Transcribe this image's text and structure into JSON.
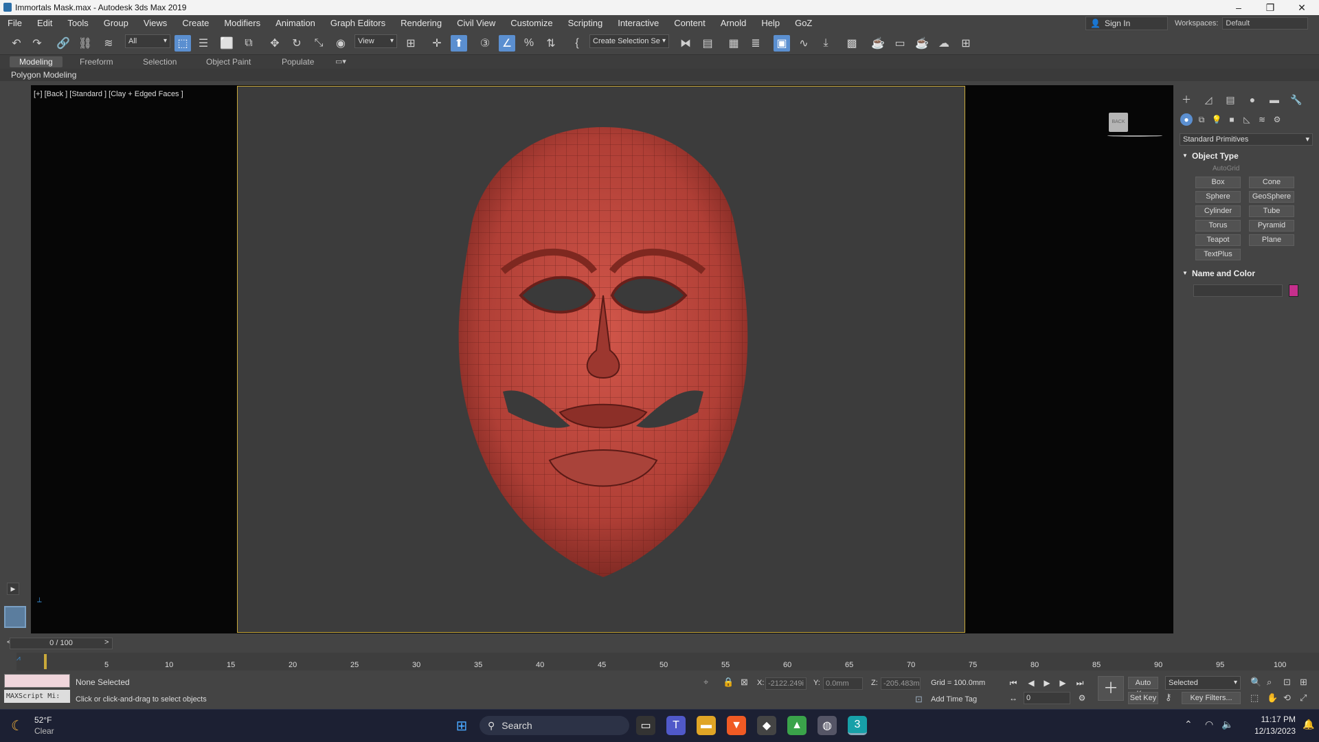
{
  "title": "Immortals Mask.max - Autodesk 3ds Max 2019",
  "menu": [
    "File",
    "Edit",
    "Tools",
    "Group",
    "Views",
    "Create",
    "Modifiers",
    "Animation",
    "Graph Editors",
    "Rendering",
    "Civil View",
    "Customize",
    "Scripting",
    "Interactive",
    "Content",
    "Arnold",
    "Help",
    "GoZ"
  ],
  "signin": "Sign In",
  "workspace": {
    "label": "Workspaces:",
    "value": "Default"
  },
  "toolbar": {
    "filter": "All",
    "refcoord": "View",
    "selset": "Create Selection Se"
  },
  "ribbon": {
    "tabs": [
      "Modeling",
      "Freeform",
      "Selection",
      "Object Paint",
      "Populate"
    ],
    "panel": "Polygon Modeling"
  },
  "viewport": {
    "label": "[+] [Back ] [Standard ] [Clay + Edged Faces ]",
    "viewcube": "BACK"
  },
  "command_panel": {
    "dropdown": "Standard Primitives",
    "object_type": "Object Type",
    "autogrid": "AutoGrid",
    "buttons": [
      "Box",
      "Cone",
      "Sphere",
      "GeoSphere",
      "Cylinder",
      "Tube",
      "Torus",
      "Pyramid",
      "Teapot",
      "Plane",
      "TextPlus"
    ],
    "name_and_color": "Name and Color",
    "object_color": "#c62f8d"
  },
  "timeline": {
    "slider": "0 / 100",
    "ticks": [
      "5",
      "10",
      "15",
      "20",
      "25",
      "30",
      "35",
      "40",
      "45",
      "50",
      "55",
      "60",
      "65",
      "70",
      "75",
      "80",
      "85",
      "90",
      "95",
      "100"
    ]
  },
  "status": {
    "selection": "None Selected",
    "prompt": "Click or click-and-drag to select objects",
    "maxscript": "MAXScript Mi:",
    "x": "-2122.249i",
    "y": "0.0mm",
    "z": "-205.483m",
    "grid": "Grid = 100.0mm",
    "addtimetag": "Add Time Tag",
    "autokey": "Auto Key",
    "selected": "Selected",
    "setkey": "Set Key",
    "keyfilters": "Key Filters...",
    "frame": "0"
  },
  "taskbar": {
    "temp": "52°F",
    "weather": "Clear",
    "search": "Search",
    "time": "11:17 PM",
    "date": "12/13/2023"
  }
}
